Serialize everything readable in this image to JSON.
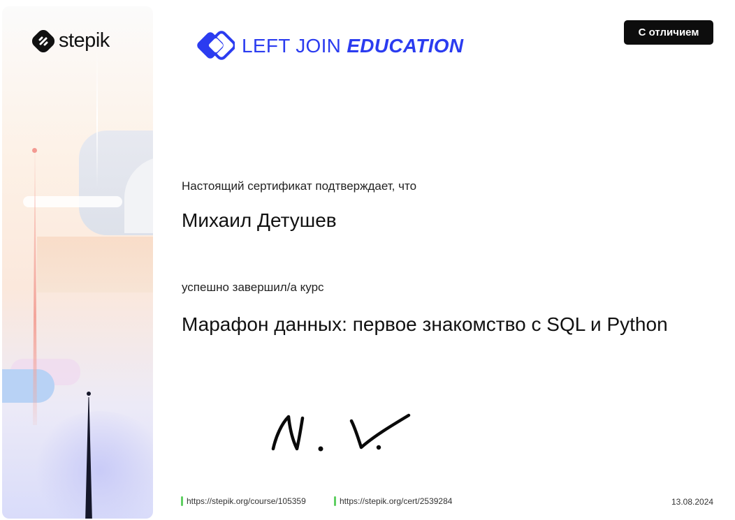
{
  "header": {
    "stepik_brand": "stepik",
    "partner_brand_part1": "LEFT JOIN",
    "partner_brand_part2": "EDUCATION",
    "badge": "С отличием"
  },
  "certificate": {
    "confirm_text": "Настоящий сертификат подтверждает, что",
    "recipient_name": "Михаил Детушев",
    "completed_text": "успешно завершил/а  курс",
    "course_title": "Марафон данных: первое знакомство с SQL и Python"
  },
  "footer": {
    "course_link": "https://stepik.org/course/105359",
    "cert_link": "https://stepik.org/cert/2539284",
    "date": "13.08.2024"
  },
  "colors": {
    "partner_blue": "#2b3cf0",
    "link_tick_green": "#5fcf62",
    "badge_black": "#0d0d0d"
  },
  "icons": [
    "stepik-logo-icon",
    "left-join-logo-icon",
    "signature"
  ]
}
